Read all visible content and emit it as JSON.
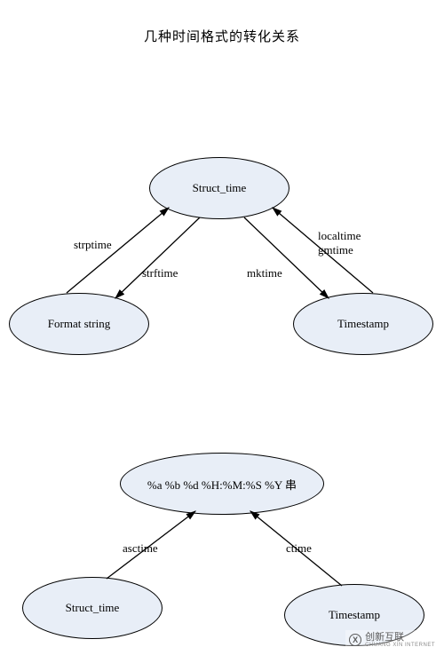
{
  "title": "几种时间格式的转化关系",
  "diagram1": {
    "nodes": {
      "struct_time": "Struct_time",
      "format_string": "Format string",
      "timestamp": "Timestamp"
    },
    "edges": {
      "strptime": "strptime",
      "strftime": "strftime",
      "mktime": "mktime",
      "localtime_gmtime": "localtime\ngmtime"
    }
  },
  "diagram2": {
    "nodes": {
      "format_spec": "%a %b %d %H:%M:%S %Y 串",
      "struct_time": "Struct_time",
      "timestamp": "Timestamp"
    },
    "edges": {
      "asctime": "asctime",
      "ctime": "ctime"
    }
  },
  "watermark": {
    "logo_letter": "X",
    "brand_cn": "创新互联",
    "brand_en": "CHUANG XIN INTERNET"
  }
}
